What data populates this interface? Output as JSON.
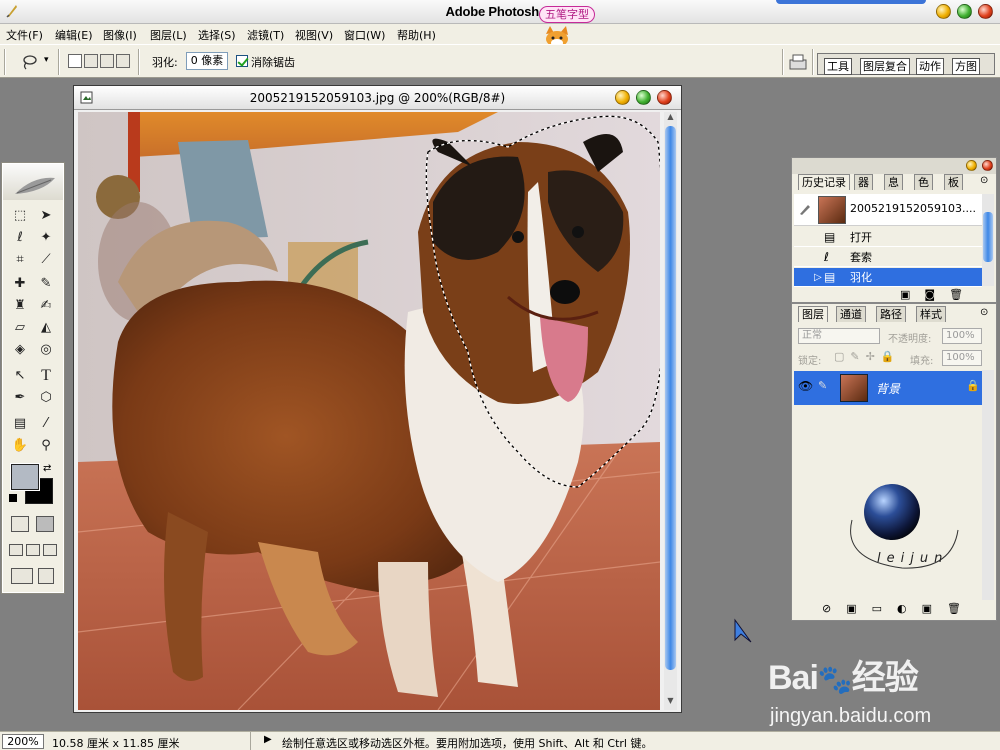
{
  "app": {
    "title": "Adobe Photoshop",
    "badge": "五笔字型"
  },
  "menu": [
    "文件(F)",
    "编辑(E)",
    "图像(I)",
    "图层(L)",
    "选择(S)",
    "滤镜(T)",
    "视图(V)",
    "窗口(W)",
    "帮助(H)"
  ],
  "options": {
    "feather_label": "羽化:",
    "feather_value": "0 像素",
    "antialias_label": "消除锯齿",
    "antialias_checked": true
  },
  "palette_well": [
    "工具",
    "图层复合",
    "动作",
    "方图"
  ],
  "document": {
    "title": "2005219152059103.jpg @ 200%(RGB/8#)"
  },
  "history": {
    "tabs": [
      "历史记录",
      "器",
      "息",
      "色",
      "板"
    ],
    "snapshot": "2005219152059103....",
    "steps": [
      "打开",
      "套索",
      "羽化"
    ],
    "selected_step": "羽化"
  },
  "layers": {
    "tabs": [
      "图层",
      "通道",
      "路径",
      "样式"
    ],
    "blend_mode": "正常",
    "opacity_label": "不透明度:",
    "opacity_value": "100%",
    "lock_label": "锁定:",
    "fill_label": "填充:",
    "fill_value": "100%",
    "layer_name": "背景",
    "globe_text": "leijun"
  },
  "status": {
    "zoom": "200%",
    "doc_size": "10.58 厘米 x 11.85 厘米",
    "hint": "绘制任意选区或移动选区外框。要用附加选项，使用 Shift、Alt 和 Ctrl 键。"
  },
  "watermark": {
    "brand": "Bai",
    "brand2": "经验",
    "url": "jingyan.baidu.com"
  },
  "colors": {
    "selection_blue": "#2f6fe0",
    "foreground": "#b3bac4",
    "background": "#000000"
  }
}
